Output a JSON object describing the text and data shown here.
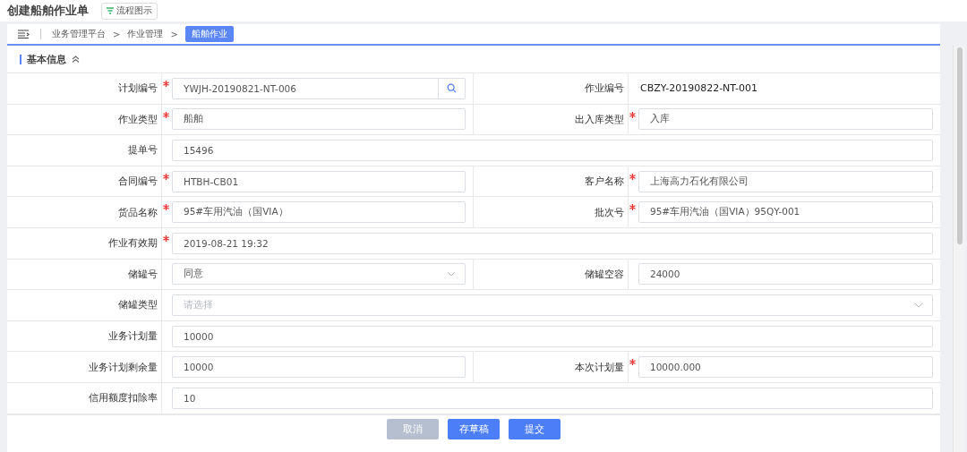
{
  "page_title": "创建船舶作业单",
  "flow_button": {
    "label": "流程图示"
  },
  "breadcrumb": [
    {
      "label": "业务管理平台",
      "current": false
    },
    {
      "label": ">",
      "kind": "separator"
    },
    {
      "label": "作业管理",
      "current": false
    },
    {
      "label": ">",
      "kind": "separator"
    },
    {
      "label": "船舶作业",
      "current": true
    }
  ],
  "section": {
    "title": "基本信息",
    "expanded": true
  },
  "form_rows": [
    {
      "fields": [
        {
          "label": "计划编号",
          "required": true,
          "kind": "search",
          "value": "YWJH-20190821-NT-006"
        },
        {
          "label": "作业编号",
          "required": false,
          "kind": "static",
          "value": "CBZY-20190822-NT-001"
        }
      ]
    },
    {
      "fields": [
        {
          "label": "作业类型",
          "required": true,
          "kind": "text",
          "value": "船舶"
        },
        {
          "label": "出入库类型",
          "required": true,
          "kind": "text",
          "value": "入库"
        }
      ]
    },
    {
      "fields": [
        {
          "label": "提单号",
          "required": false,
          "kind": "text",
          "value": "15496"
        }
      ]
    },
    {
      "fields": [
        {
          "label": "合同编号",
          "required": true,
          "kind": "text",
          "value": "HTBH-CB01"
        },
        {
          "label": "客户名称",
          "required": true,
          "kind": "text",
          "value": "上海高力石化有限公司"
        }
      ]
    },
    {
      "fields": [
        {
          "label": "货品名称",
          "required": true,
          "kind": "text",
          "value": "95#车用汽油（国VIA）"
        },
        {
          "label": "批次号",
          "required": true,
          "kind": "text",
          "value": "95#车用汽油（国VIA）95QY-001"
        }
      ]
    },
    {
      "fields": [
        {
          "label": "作业有效期",
          "required": true,
          "kind": "text",
          "value": "2019-08-21 19:32"
        }
      ]
    },
    {
      "fields": [
        {
          "label": "储罐号",
          "required": false,
          "kind": "select",
          "value": "同意"
        },
        {
          "label": "储罐空容",
          "required": false,
          "kind": "text",
          "value": "24000"
        }
      ]
    },
    {
      "fields": [
        {
          "label": "储罐类型",
          "required": false,
          "kind": "select",
          "placeholder": "请选择"
        }
      ]
    },
    {
      "fields": [
        {
          "label": "业务计划量",
          "required": false,
          "kind": "text",
          "value": "10000"
        }
      ]
    },
    {
      "fields": [
        {
          "label": "业务计划剩余量",
          "required": false,
          "kind": "text",
          "value": "10000"
        },
        {
          "label": "本次计划量",
          "required": true,
          "kind": "text",
          "value": "10000.000"
        }
      ]
    },
    {
      "fields": [
        {
          "label": "信用额度扣除率",
          "required": false,
          "kind": "text",
          "value": "10"
        }
      ]
    }
  ],
  "actions": [
    {
      "label": "取消",
      "disabled": true
    },
    {
      "label": "存草稿",
      "disabled": false
    },
    {
      "label": "提交",
      "disabled": false
    }
  ]
}
